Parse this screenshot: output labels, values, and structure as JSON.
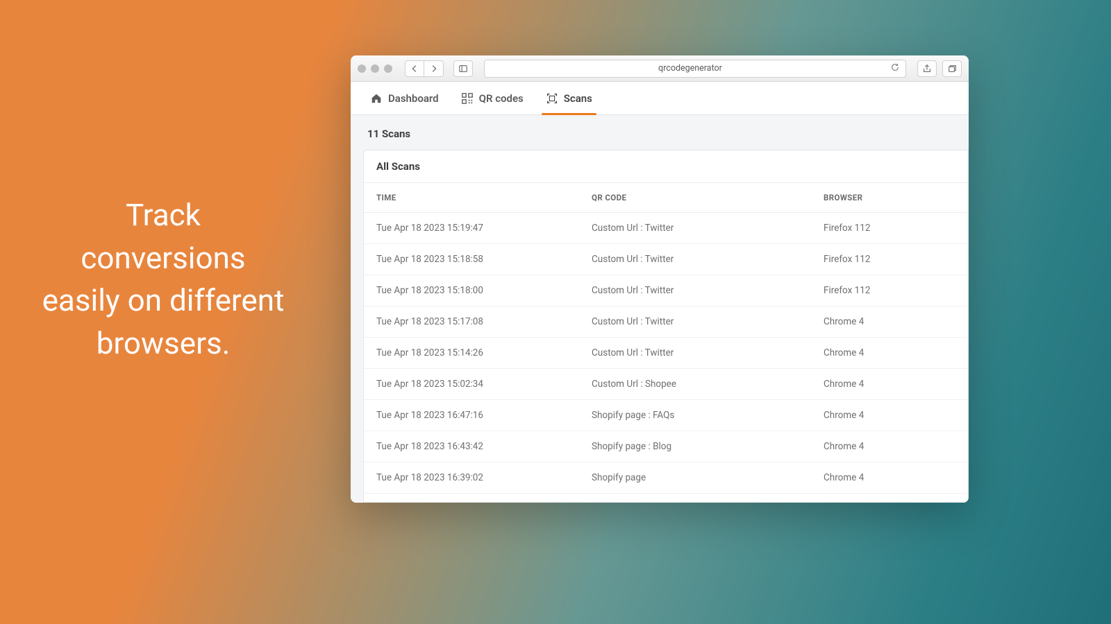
{
  "headline": "Track conversions easily on different browsers.",
  "chrome": {
    "url": "qrcodegenerator"
  },
  "tabs": [
    {
      "label": "Dashboard"
    },
    {
      "label": "QR codes"
    },
    {
      "label": "Scans"
    }
  ],
  "scans_count": "11 Scans",
  "card_title": "All Scans",
  "columns": {
    "time": "TIME",
    "qr": "QR CODE",
    "browser": "BROWSER"
  },
  "rows": [
    {
      "time": "Tue Apr 18 2023 15:19:47",
      "qr": "Custom Url : Twitter",
      "browser": "Firefox 112"
    },
    {
      "time": "Tue Apr 18 2023 15:18:58",
      "qr": "Custom Url : Twitter",
      "browser": "Firefox 112"
    },
    {
      "time": "Tue Apr 18 2023 15:18:00",
      "qr": "Custom Url : Twitter",
      "browser": "Firefox 112"
    },
    {
      "time": "Tue Apr 18 2023 15:17:08",
      "qr": "Custom Url : Twitter",
      "browser": "Chrome 4"
    },
    {
      "time": "Tue Apr 18 2023 15:14:26",
      "qr": "Custom Url : Twitter",
      "browser": "Chrome 4"
    },
    {
      "time": "Tue Apr 18 2023 15:02:34",
      "qr": "Custom Url : Shopee",
      "browser": "Chrome 4"
    },
    {
      "time": "Tue Apr 18 2023 16:47:16",
      "qr": "Shopify page : FAQs",
      "browser": "Chrome 4"
    },
    {
      "time": "Tue Apr 18 2023 16:43:42",
      "qr": "Shopify page : Blog",
      "browser": "Chrome 4"
    },
    {
      "time": "Tue Apr 18 2023 16:39:02",
      "qr": "Shopify page",
      "browser": "Chrome 4"
    }
  ]
}
